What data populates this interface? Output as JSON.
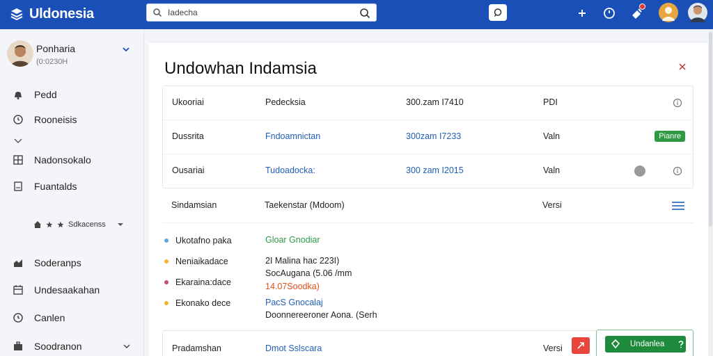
{
  "app": {
    "brand": "Uldonesia",
    "colors": {
      "topbar": "#1b4fb8",
      "accent_green": "#2e9a44",
      "link_blue": "#1f5fb5",
      "danger": "#e8453c"
    }
  },
  "search": {
    "value": "Iadecha",
    "placeholder": "Iadecha"
  },
  "profile": {
    "name": "Ponharia",
    "sub": "(0:0230H"
  },
  "sidebar": {
    "items": [
      {
        "label": "Pedd",
        "icon": "bell-icon"
      },
      {
        "label": "Rooneisis",
        "icon": "clock-icon"
      },
      {
        "label": "Nadonsokalo",
        "icon": "grid-icon"
      },
      {
        "label": "Fuantalds",
        "icon": "document-icon"
      },
      {
        "label": "Soderanps",
        "icon": "chart-icon"
      },
      {
        "label": "Undesaakahan",
        "icon": "calendar-icon"
      },
      {
        "label": "Canlen",
        "icon": "clock-icon"
      },
      {
        "label": "Soodranon",
        "icon": "briefcase-icon"
      }
    ],
    "subrow": {
      "label": "Sdkacenss"
    }
  },
  "main": {
    "title": "Undowhan Indamsia",
    "rows": [
      {
        "c1": "Ukooriai",
        "c2": "Pedecksia",
        "c3": "300.zam I7410",
        "c4": "PDI"
      },
      {
        "c1": "Dussrita",
        "c2": "Fndoamnictan",
        "c3": "300zam I7233",
        "c4": "Valn",
        "badge": "Pianre"
      },
      {
        "c1": "Ousariai",
        "c2": "Tudoadocka:",
        "c3": "300 zam I2015",
        "c4": "Valn"
      }
    ],
    "row_plain": {
      "c1": "Sindamsian",
      "c2": "Taekenstar (Mdoom)",
      "c4": "Versi"
    },
    "legend": [
      {
        "label": "Ukotafno paka",
        "color": "#5aa6e0",
        "value": "Gloar Gnodiar",
        "value_color": "green"
      },
      {
        "label": "Neniaikadace",
        "color": "#f0b429",
        "value": "2I Malina hac 223I)"
      },
      {
        "label": "Ekaraina:dace",
        "color": "#c0506d",
        "value": "SocAugana (5.06 /mm",
        "extra": "14.07Soodka)"
      },
      {
        "label": "Ekonako dece",
        "color": "#f0b429",
        "value": "PacS Gnocalaj",
        "value_color": "blue",
        "extra": "Doonnereeroner Aona. (Serh"
      }
    ],
    "bottom": {
      "c1": "Pradamshan",
      "c2": "Dmot Sslscara",
      "c4": "Versi",
      "button": "Undanlea"
    }
  }
}
